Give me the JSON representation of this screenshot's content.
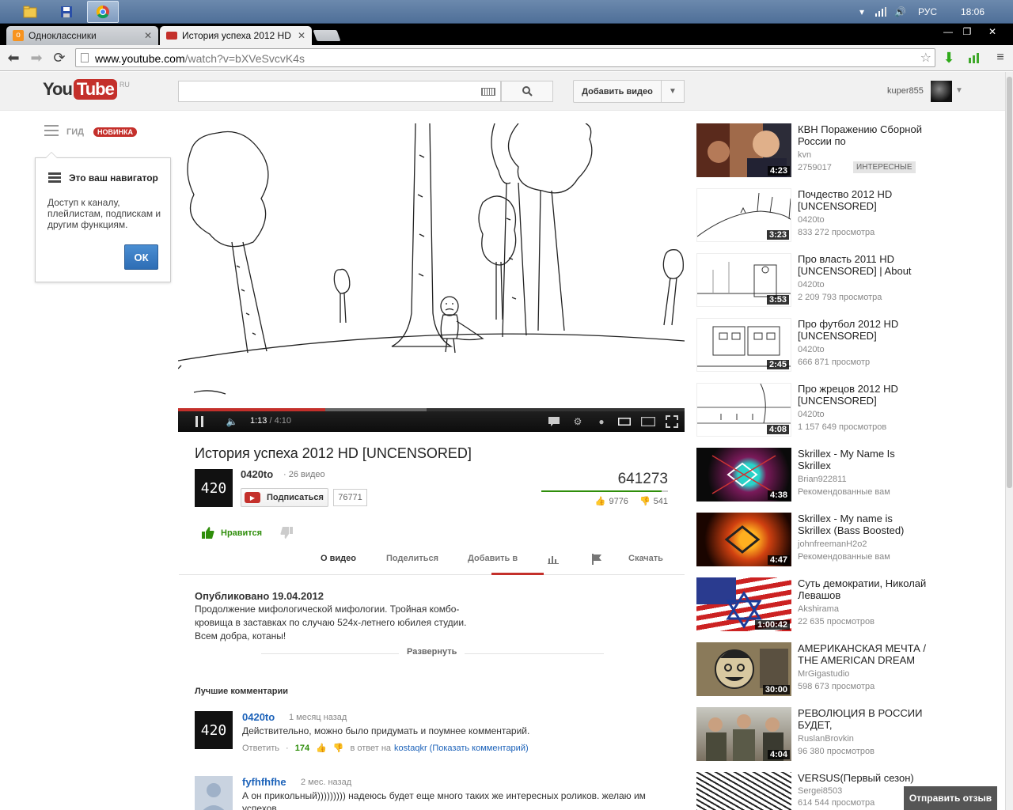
{
  "taskbar": {
    "lang": "РУС",
    "clock": "18:06"
  },
  "tabs": [
    {
      "label": "Одноклассники"
    },
    {
      "label": "История успеха 2012 HD"
    }
  ],
  "address_bar": {
    "domain": "www.youtube.com",
    "path": "/watch?v=bXVeSvcvK4s"
  },
  "header": {
    "logo_you": "You",
    "logo_tube": "Tube",
    "logo_region": "RU",
    "search_placeholder": "",
    "upload_label": "Добавить видео",
    "username": "kuper855"
  },
  "guide": {
    "label": "ГИД",
    "badge": "НОВИНКА",
    "popup_title": "Это ваш навигатор",
    "popup_text": "Доступ к каналу, плейлистам, подпискам и другим функциям.",
    "popup_ok": "ОК"
  },
  "player": {
    "current_time": "1:13",
    "duration": "4:10",
    "played_fraction": 0.29,
    "buffered_fraction": 0.49
  },
  "video": {
    "title": "История успеха 2012 HD [UNCENSORED]",
    "channel": "0420to",
    "channel_thumb_text": "420",
    "video_count": "26 видео",
    "subscribe_label": "Подписаться",
    "subscriber_count": "76771",
    "views": "641273",
    "likes": "9776",
    "dislikes": "541",
    "like_label": "Нравится"
  },
  "watch_tabs": {
    "about": "О видео",
    "share": "Поделиться",
    "add_to": "Добавить в",
    "download": "Скачать"
  },
  "description": {
    "published": "Опубликовано 19.04.2012",
    "lines": [
      "Продолжение мифологической мифологии. Тройная комбо-",
      "кровища в заставках по случаю 524х-летнего юбилея студии.",
      "Всем добра, котаны!"
    ],
    "expand": "Развернуть"
  },
  "comments": {
    "title": "Лучшие комментарии",
    "items": [
      {
        "author": "0420to",
        "ago": "1 месяц назад",
        "text": "Действительно, можно было придумать и поумнее комментарий.",
        "reply": "Ответить",
        "votes": "174",
        "in_reply_prefix": "в ответ на",
        "in_reply_link": "kostaqkr (Показать комментарий)"
      },
      {
        "author": "fyfhfhfhe",
        "ago": "2 мес. назад",
        "text": "А он прикольный))))))))) надеюсь будет еще много таких же интересных роликов. желаю им успехов"
      }
    ]
  },
  "related": [
    {
      "title": "КВН Поражению Сборной России по",
      "author": "kvn",
      "views": "2759017",
      "duration": "4:23",
      "badge": "ИНТЕРЕСНЫЕ"
    },
    {
      "title": "Почдество 2012 HD [UNCENSORED]",
      "author": "0420to",
      "views": "833 272 просмотра",
      "duration": "3:23"
    },
    {
      "title": "Про власть 2011 HD [UNCENSORED] | About",
      "author": "0420to",
      "views": "2 209 793 просмотра",
      "duration": "3:53"
    },
    {
      "title": "Про футбол 2012 HD [UNCENSORED]",
      "author": "0420to",
      "views": "666 871 просмотр",
      "duration": "2:45"
    },
    {
      "title": "Про жрецов 2012 HD [UNCENSORED]",
      "author": "0420to",
      "views": "1 157 649 просмотров",
      "duration": "4:08"
    },
    {
      "title": "Skrillex - My Name Is Skrillex",
      "author": "Brian922811",
      "views": "Рекомендованные вам",
      "duration": "4:38"
    },
    {
      "title": "Skrillex - My name is Skrillex (Bass Boosted)",
      "author": "johnfreemanH2o2",
      "views": "Рекомендованные вам",
      "duration": "4:47"
    },
    {
      "title": "Суть демократии, Николай Левашов",
      "author": "Akshirama",
      "views": "22 635 просмотров",
      "duration": "1:00:42"
    },
    {
      "title": "АМЕРИКАНСКАЯ МЕЧТА / THE AMERICAN DREAM",
      "author": "MrGigastudio",
      "views": "598 673 просмотра",
      "duration": "30:00"
    },
    {
      "title": "РЕВОЛЮЦИЯ В РОССИИ БУДЕТ,",
      "author": "RuslanBrovkin",
      "views": "96 380 просмотров",
      "duration": "4:04"
    },
    {
      "title": "VERSUS(Первый сезон)",
      "author": "Sergei8503",
      "views": "614 544 просмотра",
      "duration": ""
    }
  ],
  "feedback": "Отправить отзыв",
  "colors": {
    "youtube_red": "#c4302b",
    "like_green": "#2f8e0b",
    "link_blue": "#1c62b9"
  }
}
